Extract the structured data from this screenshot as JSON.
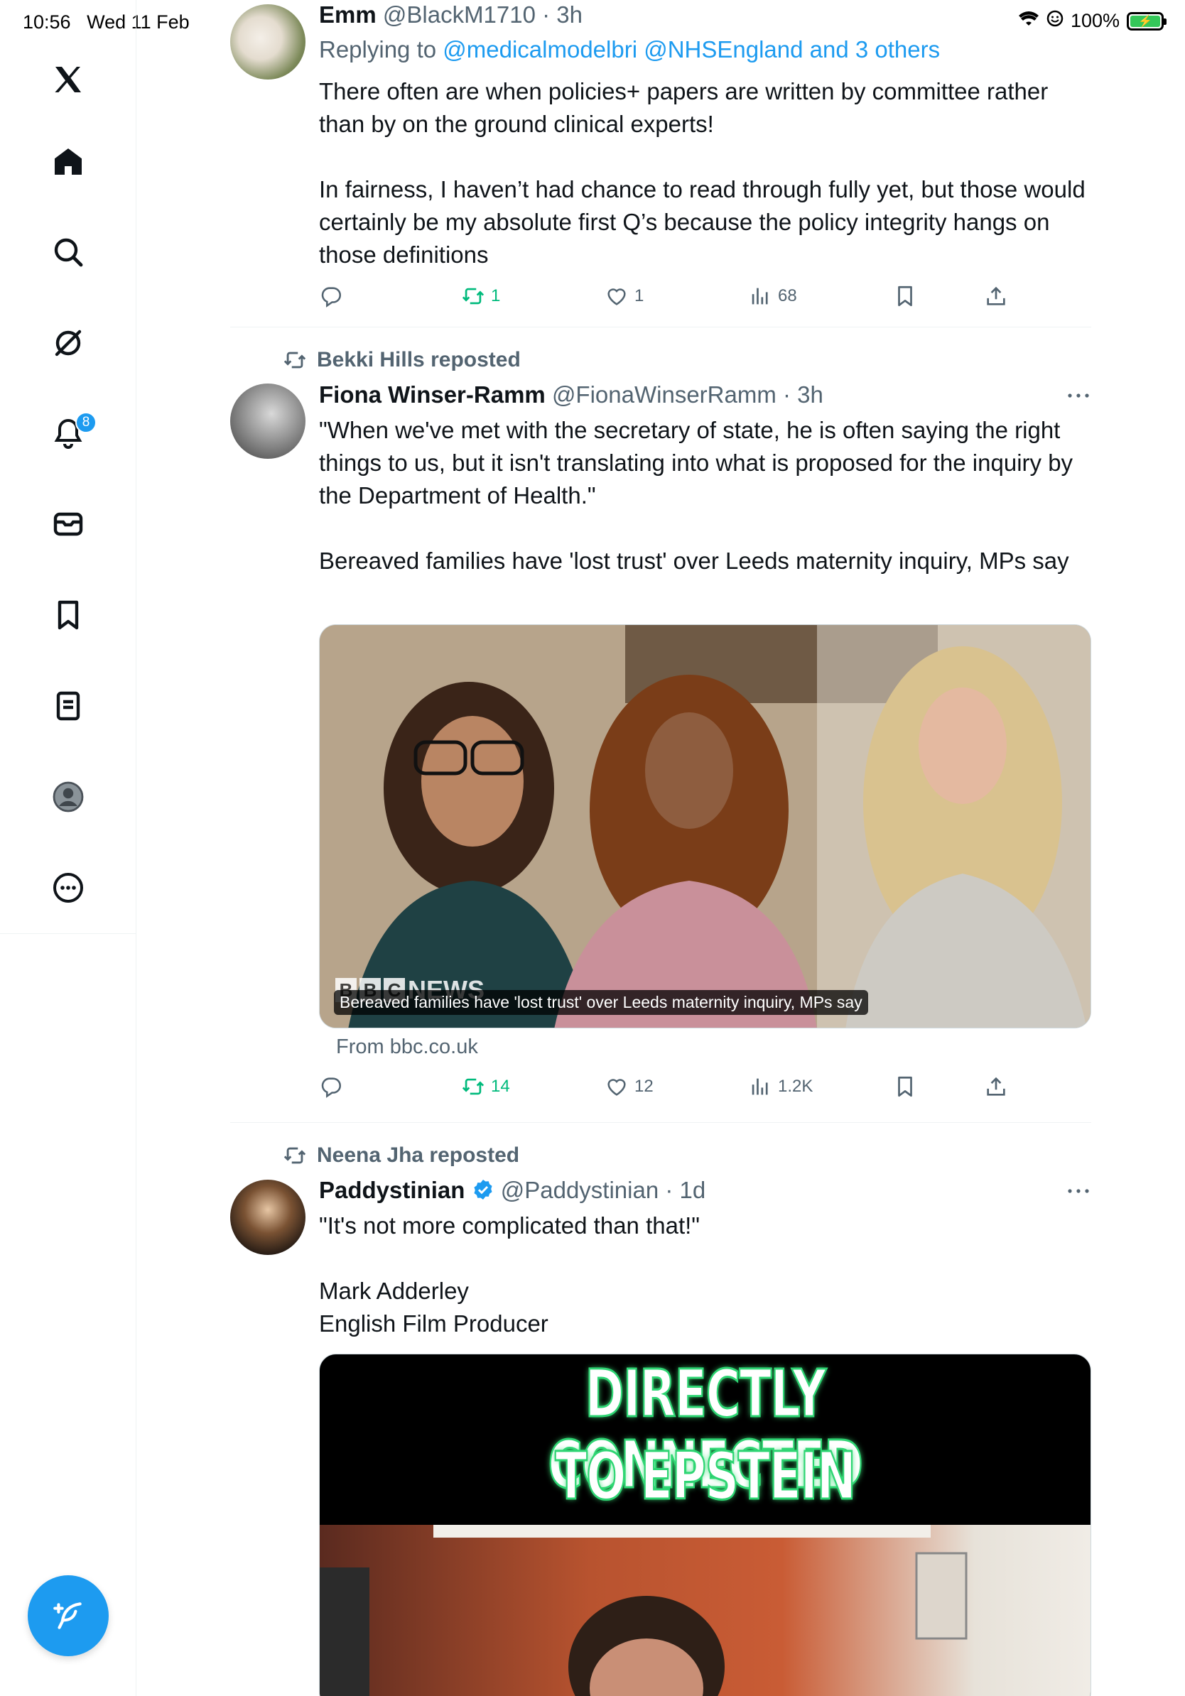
{
  "status_bar": {
    "time": "10:56",
    "date": "Wed 11 Feb",
    "battery": "100%"
  },
  "sidebar": {
    "items": [
      {
        "name": "x-logo-icon"
      },
      {
        "name": "home-icon"
      },
      {
        "name": "search-icon"
      },
      {
        "name": "grok-icon"
      },
      {
        "name": "notifications-icon"
      },
      {
        "name": "messages-icon"
      },
      {
        "name": "bookmarks-icon"
      },
      {
        "name": "lists-icon"
      },
      {
        "name": "profile-icon"
      },
      {
        "name": "more-icon"
      }
    ],
    "notification_count": "8"
  },
  "colors": {
    "accent": "#1d9bf0",
    "retweet_green": "#00ba7c",
    "secondary_text": "#536471"
  },
  "tweets": [
    {
      "name": "Emm",
      "handle": "@BlackM1710 · 3h",
      "replying_prefix": "Replying to ",
      "replying_to": "@medicalmodelbri @NHSEngland and 3 others",
      "text": "There often are when policies+ papers are written by committee rather than by on the ground clinical experts!\n\nIn fairness, I haven’t had chance to read through fully yet, but those would certainly be my absolute first Q’s because the policy integrity hangs on those definitions",
      "retweets": "1",
      "likes": "1",
      "views": "68"
    },
    {
      "reposted_by": "Bekki Hills reposted",
      "name": "Fiona Winser-Ramm",
      "handle": "@FionaWinserRamm · 3h",
      "text": "\"When we've met with the secretary of state, he is often saying the right things to us, but it isn't translating into what is proposed for the inquiry by the Department of Health.\"\n\nBereaved families have 'lost trust' over Leeds maternity inquiry, MPs say",
      "card_logo": "NEWS",
      "card_caption": "Bereaved families have 'lost trust' over Leeds maternity inquiry, MPs say",
      "card_source": "From bbc.co.uk",
      "retweets": "14",
      "likes": "12",
      "views": "1.2K"
    },
    {
      "reposted_by": "Neena Jha reposted",
      "name": "Paddystinian",
      "handle": "@Paddystinian · 1d",
      "text": "\"It's not more complicated than that!\"\n\nMark Adderley\nEnglish Film Producer",
      "video_line1": "DIRECTLY CONNECTED",
      "video_line2": "TO EPSTEIN"
    }
  ]
}
